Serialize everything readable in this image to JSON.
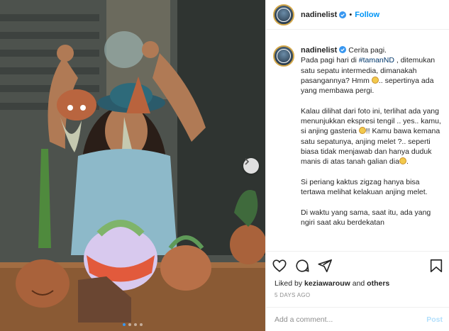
{
  "post": {
    "username": "nadinelist",
    "separator": "•",
    "follow_label": "Follow"
  },
  "caption": {
    "username": "nadinelist",
    "text_1": " Cerita pagi.\nPada pagi hari di ",
    "hashtag": "#tamanND",
    "text_2": " , ditemukan satu sepatu intermedia, dimanakah pasangannya? Hmm ",
    "text_3": ".. sepertinya ada yang membawa pergi.\n\nKalau dilihat dari foto ini, terlihat ada yang menunjukkan ekspresi tengil .. yes.. kamu, si anjing gasteria ",
    "text_4": "!! Kamu bawa kemana satu sepatunya, anjing melet ?.. seperti biasa tidak menjawab dan hanya duduk manis di atas tanah galian dia",
    "text_5": ".\n\nSi periang kaktus zigzag hanya bisa tertawa melihat kelakuan anjing melet.\n\nDi waktu yang sama, saat itu, ada yang ngiri saat aku berdekatan"
  },
  "actions": {
    "icons": [
      "heart-icon",
      "comment-icon",
      "share-icon",
      "bookmark-icon"
    ],
    "liked_by_prefix": "Liked by ",
    "liked_by_user": "keziawarouw",
    "liked_by_suffix": " and ",
    "liked_by_others": "others",
    "timestamp": "5 DAYS AGO"
  },
  "comment": {
    "placeholder": "Add a comment...",
    "post_label": "Post"
  },
  "carousel": {
    "slide_count": 4,
    "active_slide": 1
  },
  "colors": {
    "link_blue": "#0095f6",
    "post_disabled": "#b2dffc",
    "hashtag": "#00376b",
    "verified_blue": "#3897f0",
    "muted_gray": "#8e8e8e"
  }
}
